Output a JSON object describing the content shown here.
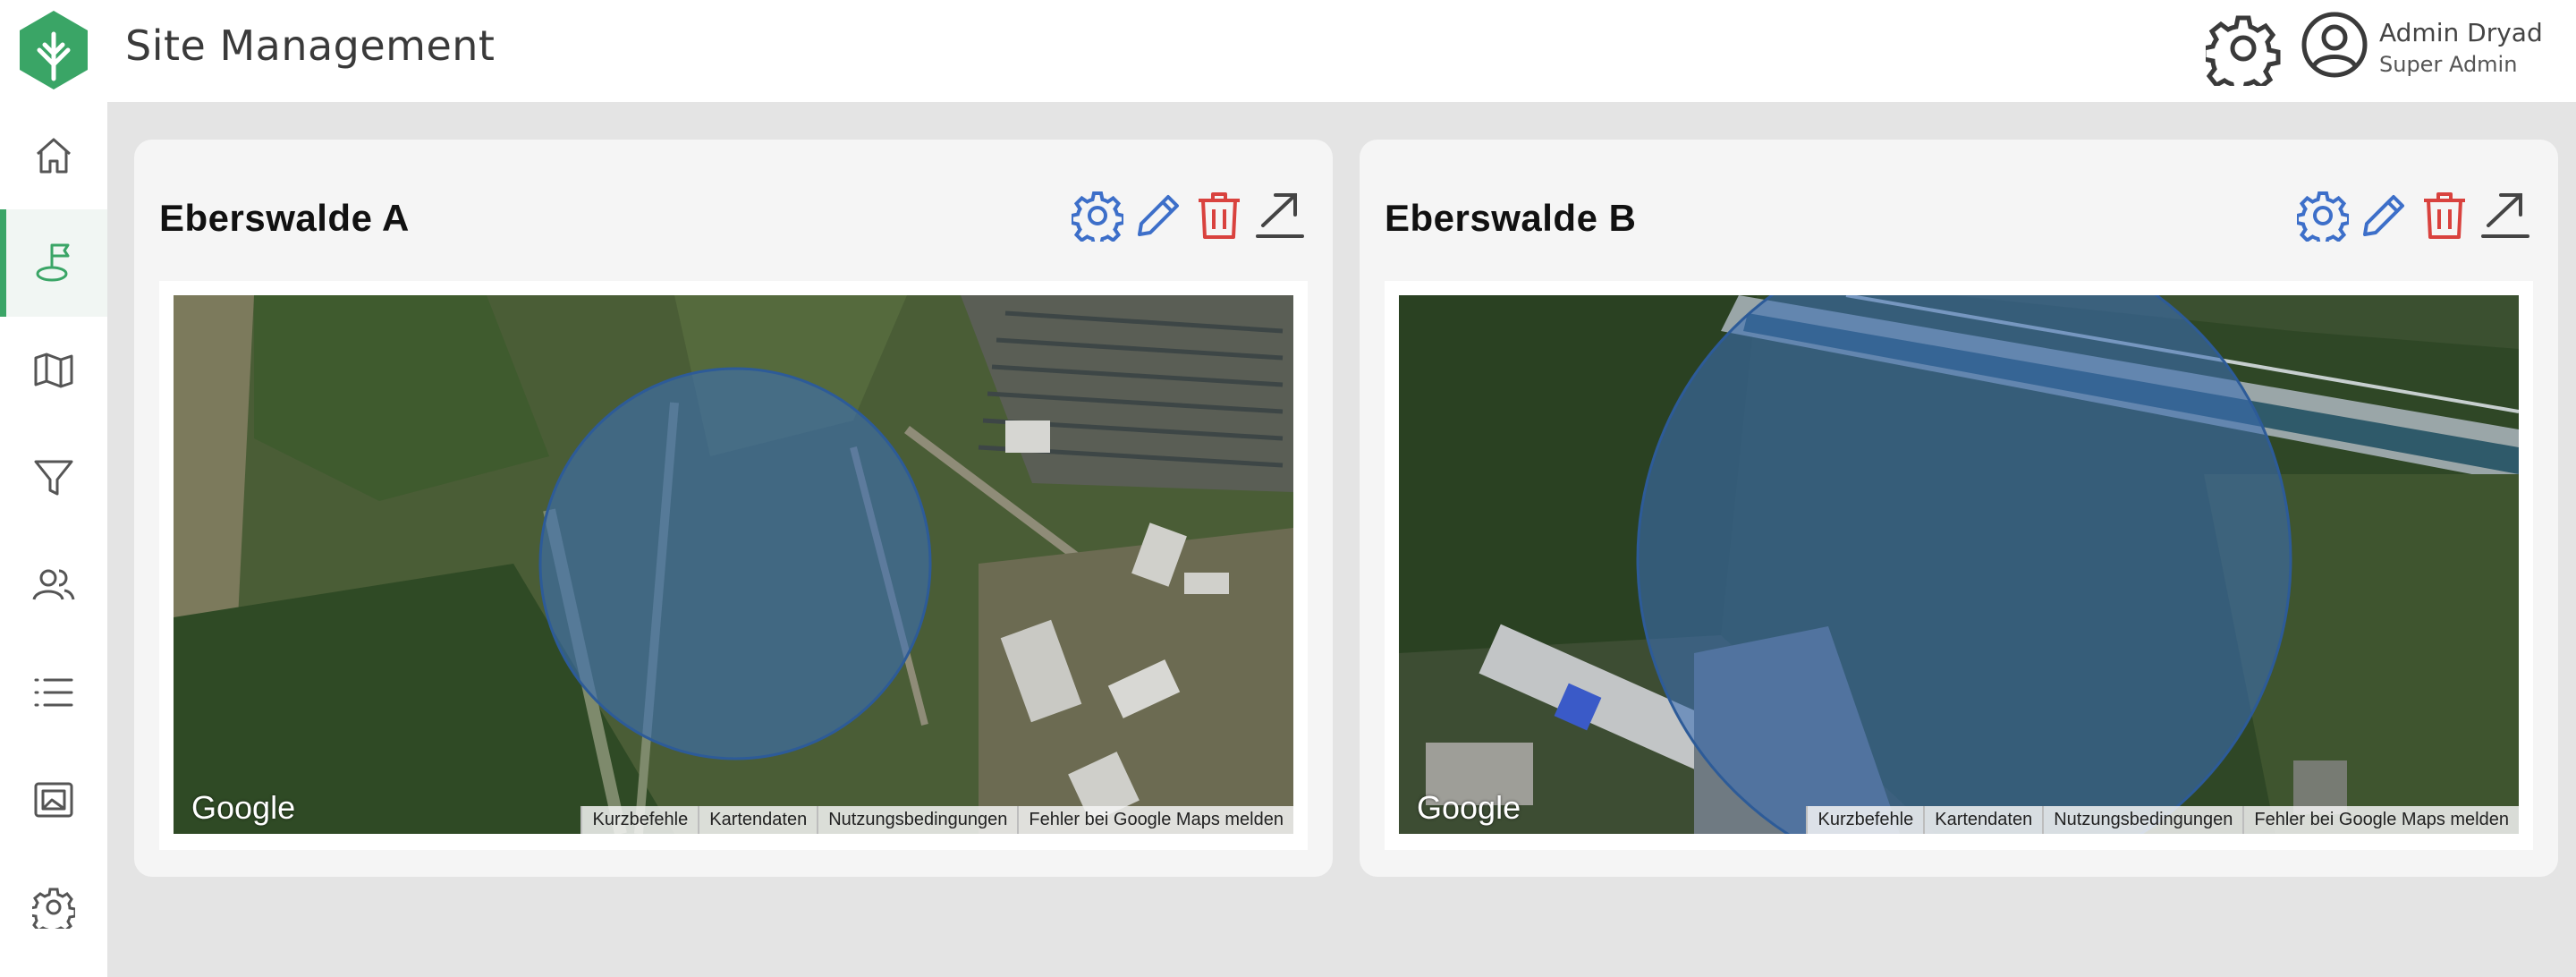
{
  "header": {
    "title": "Site Management",
    "user": {
      "name": "Admin Dryad",
      "role": "Super Admin"
    }
  },
  "brand": {
    "accent": "#3aa566",
    "action_blue": "#3d6fc9",
    "delete_red": "#d9423e"
  },
  "sidebar": {
    "items": [
      {
        "icon": "home-icon"
      },
      {
        "icon": "site-flag-icon",
        "active": true
      },
      {
        "icon": "map-icon"
      },
      {
        "icon": "filter-icon"
      },
      {
        "icon": "users-icon"
      },
      {
        "icon": "list-icon"
      },
      {
        "icon": "gallery-icon"
      },
      {
        "icon": "gear-icon"
      }
    ]
  },
  "cards": [
    {
      "title": "Eberswalde A",
      "map": {
        "brand": "Google",
        "attribution": [
          "Kurzbefehle",
          "Kartendaten",
          "Nutzungsbedingungen",
          "Fehler bei Google Maps melden"
        ]
      }
    },
    {
      "title": "Eberswalde B",
      "map": {
        "brand": "Google",
        "attribution": [
          "Kurzbefehle",
          "Kartendaten",
          "Nutzungsbedingungen",
          "Fehler bei Google Maps melden"
        ]
      }
    }
  ]
}
